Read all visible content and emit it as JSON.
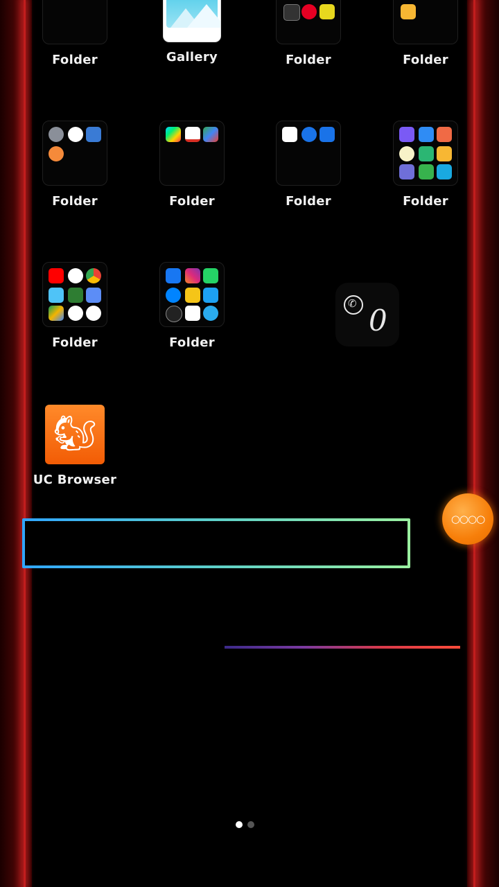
{
  "home": {
    "row1": [
      {
        "label": "Folder"
      },
      {
        "label": "Gallery"
      },
      {
        "label": "Folder"
      },
      {
        "label": "Folder"
      }
    ],
    "row2": [
      {
        "label": "Folder"
      },
      {
        "label": "Folder"
      },
      {
        "label": "Folder"
      },
      {
        "label": "Folder"
      }
    ],
    "row3": [
      {
        "label": "Folder"
      },
      {
        "label": "Folder"
      }
    ],
    "uc_browser": {
      "label": "UC Browser"
    },
    "whatsapp_widget": {
      "count": "0",
      "icon": "whatsapp-icon"
    },
    "fab": {
      "label": "○○○○"
    },
    "page_indicator": {
      "current": 1,
      "total": 2
    }
  },
  "colors": {
    "background": "#000000",
    "edge_red": "#c21d1d",
    "uc_orange": "#f77f0a",
    "search_gradient": [
      "#2fa6ff",
      "#9af0a0"
    ]
  }
}
